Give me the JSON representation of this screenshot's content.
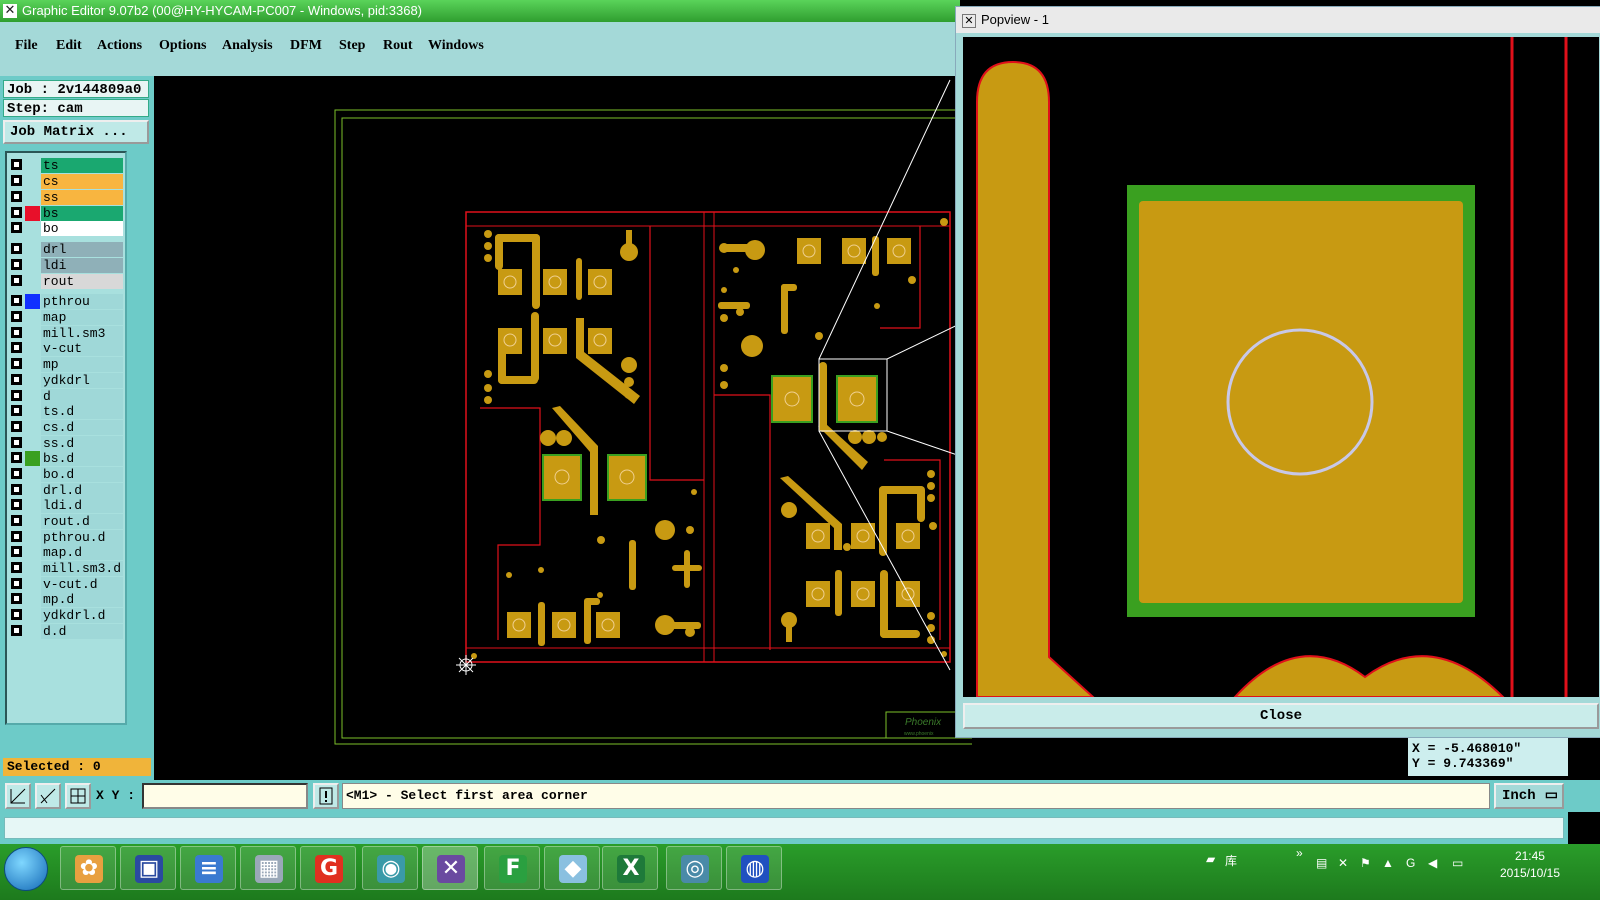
{
  "window": {
    "title": "Graphic Editor 9.07b2 (00@HY-HYCAM-PC007 - Windows, pid:3368)",
    "icon": "x-app-icon"
  },
  "menu": [
    "File",
    "Edit",
    "Actions",
    "Options",
    "Analysis",
    "DFM",
    "Step",
    "Rout",
    "Windows"
  ],
  "job": {
    "job_label": "Job : 2v144809a0",
    "step_label": "Step: cam",
    "matrix_button": "Job Matrix ..."
  },
  "layers": [
    {
      "name": "ts",
      "color": "#1aa870"
    },
    {
      "name": "cs",
      "color": "#f8b540"
    },
    {
      "name": "ss",
      "color": "#f8b540"
    },
    {
      "name": "bs",
      "color": "#1aa870",
      "swatch": "#e8102a",
      "active": true
    },
    {
      "name": "bo",
      "color": "#ffffff"
    },
    {
      "name": "drl",
      "color": "#8fb0b8"
    },
    {
      "name": "ldi",
      "color": "#8fb0b8"
    },
    {
      "name": "rout",
      "color": "#d8d8d8"
    },
    {
      "name": "pthrou",
      "color": "#9fd8d8",
      "swatch": "#1030ff"
    },
    {
      "name": "map",
      "color": "#9fd8d8"
    },
    {
      "name": "mill.sm3",
      "color": "#9fd8d8"
    },
    {
      "name": "v-cut",
      "color": "#9fd8d8"
    },
    {
      "name": "mp",
      "color": "#9fd8d8"
    },
    {
      "name": "ydkdrl",
      "color": "#9fd8d8"
    },
    {
      "name": "d",
      "color": "#9fd8d8"
    },
    {
      "name": "ts.d",
      "color": "#9fd8d8"
    },
    {
      "name": "cs.d",
      "color": "#9fd8d8"
    },
    {
      "name": "ss.d",
      "color": "#9fd8d8"
    },
    {
      "name": "bs.d",
      "color": "#9fd8d8",
      "swatch": "#3aa020"
    },
    {
      "name": "bo.d",
      "color": "#9fd8d8"
    },
    {
      "name": "drl.d",
      "color": "#9fd8d8"
    },
    {
      "name": "ldi.d",
      "color": "#9fd8d8"
    },
    {
      "name": "rout.d",
      "color": "#9fd8d8"
    },
    {
      "name": "pthrou.d",
      "color": "#9fd8d8"
    },
    {
      "name": "map.d",
      "color": "#9fd8d8"
    },
    {
      "name": "mill.sm3.d",
      "color": "#9fd8d8"
    },
    {
      "name": "v-cut.d",
      "color": "#9fd8d8"
    },
    {
      "name": "mp.d",
      "color": "#9fd8d8"
    },
    {
      "name": "ydkdrl.d",
      "color": "#9fd8d8"
    },
    {
      "name": "d.d",
      "color": "#9fd8d8"
    }
  ],
  "selected_label": "Selected : 0",
  "popview": {
    "title": "Popview - 1",
    "close_label": "Close"
  },
  "coords": {
    "x": "X = -5.468010\"",
    "y": "Y = 9.743369\""
  },
  "toolbar": {
    "xy_label": "X Y :",
    "xy_value": "",
    "status": "<M1> - Select first area corner",
    "unit": "Inch"
  },
  "board_text": {
    "logo": "Phoenix",
    "logo_sub": "www.phoenix"
  },
  "taskbar": {
    "apps": [
      "shell-app",
      "save-app",
      "notepad-app",
      "calc-app",
      "genesis-app",
      "eye-app",
      "x-app",
      "fx-app",
      "docs-app",
      "excel-app",
      "eye2-app",
      "globe-app"
    ],
    "tray_lib": "库",
    "time": "21:45",
    "date": "2015/10/15"
  },
  "colors": {
    "copper": "#c89a12",
    "outline": "#e0101a",
    "mask": "#3aa020",
    "frame": "#7bbf2a"
  }
}
